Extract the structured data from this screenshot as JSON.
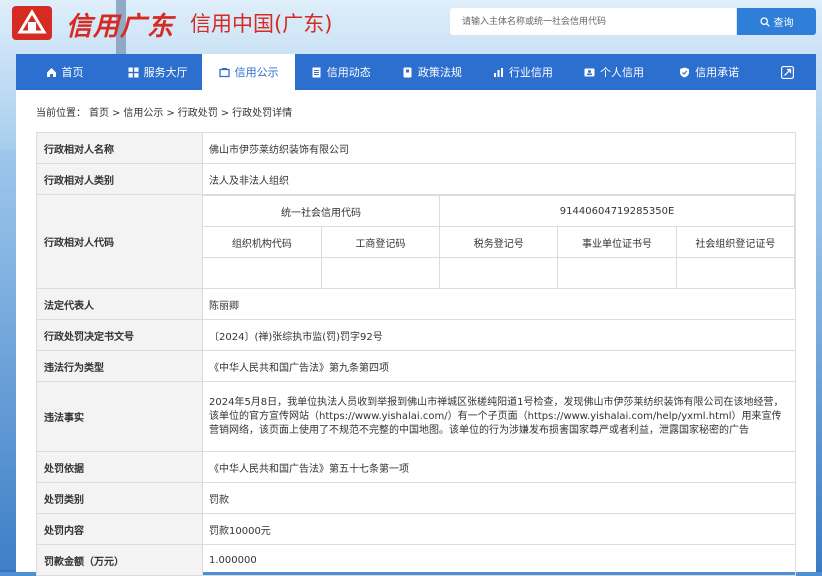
{
  "header": {
    "logo_script": "信用广东",
    "logo_title": "信用中国(广东)",
    "search_placeholder": "请输入主体名称或统一社会信用代码",
    "search_button": "查询"
  },
  "nav": [
    {
      "label": "首页",
      "icon": "home-icon"
    },
    {
      "label": "服务大厅",
      "icon": "grid-icon"
    },
    {
      "label": "信用公示",
      "icon": "announce-icon"
    },
    {
      "label": "信用动态",
      "icon": "document-icon"
    },
    {
      "label": "政策法规",
      "icon": "book-icon"
    },
    {
      "label": "行业信用",
      "icon": "chart-icon"
    },
    {
      "label": "个人信用",
      "icon": "id-card-icon"
    },
    {
      "label": "信用承诺",
      "icon": "shield-icon"
    },
    {
      "label": "",
      "icon": "expand-icon"
    }
  ],
  "breadcrumb": {
    "prefix": "当前位置：",
    "items": [
      "首页",
      "信用公示",
      "行政处罚",
      "行政处罚详情"
    ],
    "separator": ">"
  },
  "record": {
    "name_label": "行政相对人名称",
    "name_value": "佛山市伊莎莱纺织装饰有限公司",
    "type_label": "行政相对人类别",
    "type_value": "法人及非法人组织",
    "code_label": "行政相对人代码",
    "uscc_label": "统一社会信用代码",
    "uscc_value": "91440604719285350E",
    "code_headers": [
      "组织机构代码",
      "工商登记码",
      "税务登记号",
      "事业单位证书号",
      "社会组织登记证号"
    ],
    "legal_rep_label": "法定代表人",
    "legal_rep_value": "陈丽卿",
    "doc_no_label": "行政处罚决定书文号",
    "doc_no_value": "〔2024〕(禅)张综执市监(罚)罚字92号",
    "violation_type_label": "违法行为类型",
    "violation_type_value": "《中华人民共和国广告法》第九条第四项",
    "facts_label": "违法事实",
    "facts_value": "2024年5月8日，我单位执法人员收到举报到佛山市禅城区张槎纯阳道1号检查，发现佛山市伊莎莱纺织装饰有限公司在该地经营，该单位的官方宣传网站（https://www.yishalai.com/）有一个子页面（https://www.yishalai.com/help/yxml.html）用来宣传营销网络，该页面上使用了不规范不完整的中国地图。该单位的行为涉嫌发布损害国家尊严或者利益，泄露国家秘密的广告",
    "basis_label": "处罚依据",
    "basis_value": "《中华人民共和国广告法》第五十七条第一项",
    "category_label": "处罚类别",
    "category_value": "罚款",
    "content_label": "处罚内容",
    "content_value": "罚款10000元",
    "amount_label": "罚款金额（万元）",
    "amount_value": "1.000000"
  },
  "colors": {
    "brand_red": "#d62b23",
    "nav_blue": "#2d6fcf",
    "search_blue": "#2f7fd9"
  }
}
